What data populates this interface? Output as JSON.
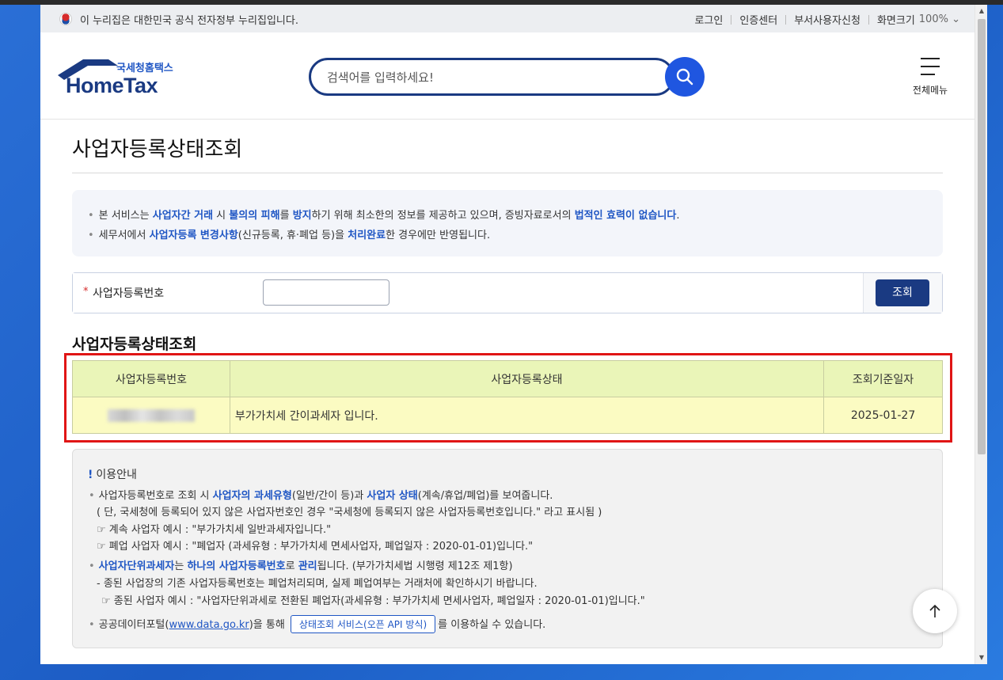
{
  "govbar": {
    "notice": "이 누리집은 대한민국 공식 전자정부 누리집입니다.",
    "links": [
      "로그인",
      "인증센터",
      "부서사용자신청",
      "화면크기"
    ],
    "zoom": "100%",
    "zoom_icon": "chevron-down-icon"
  },
  "header": {
    "logo_sub": "국세청홈택스",
    "logo_main": "HomeTax",
    "search_placeholder": "검색어를 입력하세요!",
    "menu_label": "전체메뉴"
  },
  "page": {
    "title": "사업자등록상태조회"
  },
  "info": {
    "line1": {
      "p1": "본 서비스는 ",
      "h1": "사업자간 거래",
      "p2": " 시 ",
      "h2": "불의의 피해",
      "p3": "를 ",
      "h3": "방지",
      "p4": "하기 위해 최소한의 정보를 제공하고 있으며, 증빙자료로서의 ",
      "h4": "법적인 효력이 없습니다",
      "p5": "."
    },
    "line2": {
      "p1": "세무서에서 ",
      "h1": "사업자등록 변경사항",
      "p2": "(신규등록, 휴·폐업 등)을 ",
      "h2": "처리완료",
      "p3": "한 경우에만 반영됩니다."
    }
  },
  "form": {
    "required_mark": "*",
    "label": "사업자등록번호",
    "input_value": "",
    "query_label": "조회"
  },
  "result": {
    "title": "사업자등록상태조회",
    "headers": [
      "사업자등록번호",
      "사업자등록상태",
      "조회기준일자"
    ],
    "row": {
      "status": "부가가치세 간이과세자 입니다.",
      "date": "2025-01-27"
    }
  },
  "guide": {
    "title": "이용안내",
    "l1": {
      "p1": "사업자등록번호로 조회 시 ",
      "h1": "사업자의 과세유형",
      "p2": "(일반/간이 등)과 ",
      "h2": "사업자 상태",
      "p3": "(계속/휴업/폐업)를 보여줍니다."
    },
    "l2": "( 단, 국세청에 등록되어 있지 않은 사업자번호인 경우 \"국세청에 등록되지 않은 사업자등록번호입니다.\" 라고 표시됨 )",
    "l3": "☞ 계속 사업자 예시 : \"부가가치세 일반과세자입니다.\"",
    "l4": "☞ 폐업 사업자 예시 : \"폐업자 (과세유형 : 부가가치세 면세사업자, 폐업일자 : 2020-01-01)입니다.\"",
    "l5": {
      "h1": "사업자단위과세자",
      "p1": "는 ",
      "h2": "하나의 사업자등록번호",
      "p2": "로 ",
      "h3": "관리",
      "p3": "됩니다. (부가가치세법 시행령 제12조 제1항)"
    },
    "l6": "- 종된 사업장의 기존 사업자등록번호는 폐업처리되며, 실제 폐업여부는 거래처에 확인하시기 바랍니다.",
    "l7": "☞ 종된 사업자 예시 : \"사업자단위과세로 전환된 폐업자(과세유형 : 부가가치세 면세사업자, 폐업일자 : 2020-01-01)입니다.\"",
    "l8": {
      "p1": "공공데이터포털(",
      "link": "www.data.go.kr",
      "p2": ")을 통해 ",
      "btn": "상태조회 서비스(오픈 API 방식)",
      "p3": "를 이용하실 수 있습니다."
    }
  },
  "colors": {
    "brand_navy": "#1a3a82",
    "accent_blue": "#1f56c4",
    "highlight_red": "#e01515",
    "result_header_bg": "#eaf5b8",
    "result_cell_bg": "#fbfbc2"
  }
}
